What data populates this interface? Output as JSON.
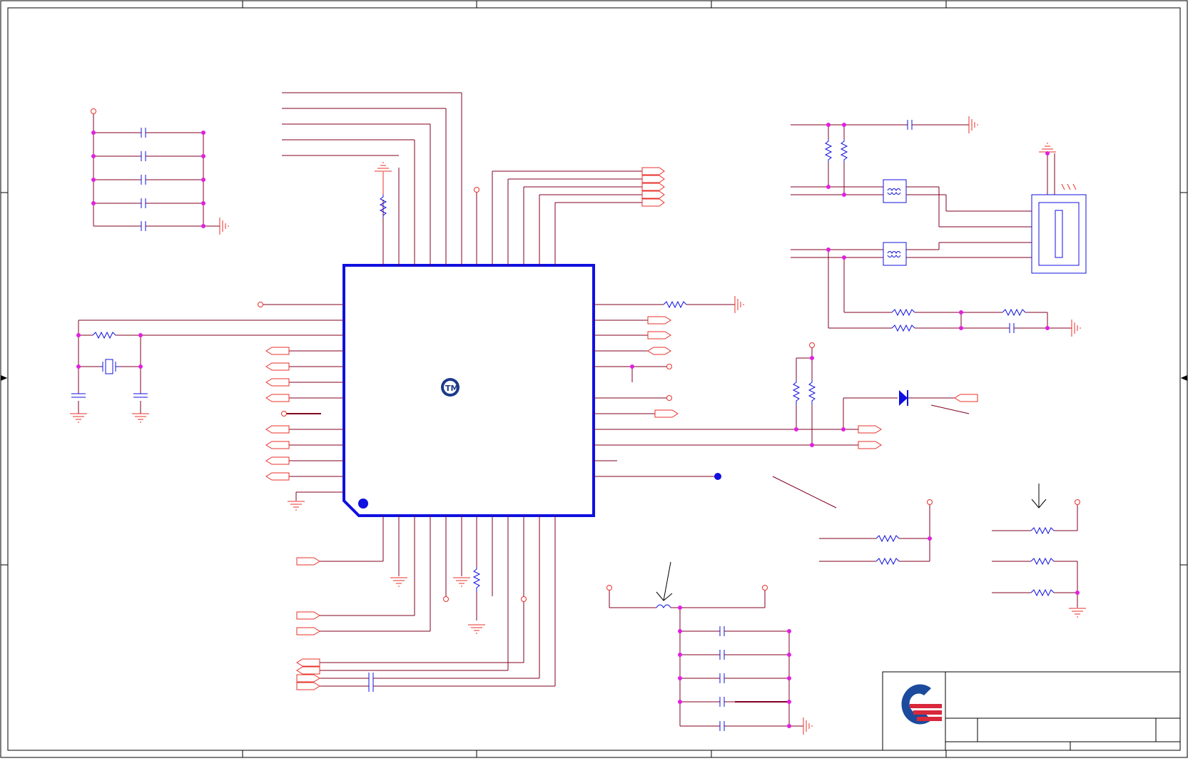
{
  "sheet": {
    "title": "",
    "logo": "company-logo-blue-red",
    "chip_marking": "TM"
  },
  "colors": {
    "wire": "#800020",
    "net_red": "#e8302a",
    "component_blue": "#0000d0",
    "junction": "#e020e0",
    "frame": "#000000",
    "logo_blue": "#1c4a9c",
    "logo_red": "#d8283a"
  },
  "components": {
    "main_ic": "qfp-ic",
    "left_decoupling_caps": 5,
    "bottom_right_caps": 5,
    "usb_common_mode_chokes": 2,
    "connector": "usb-connector",
    "diode": "led-diode",
    "crystal": "crystal"
  }
}
